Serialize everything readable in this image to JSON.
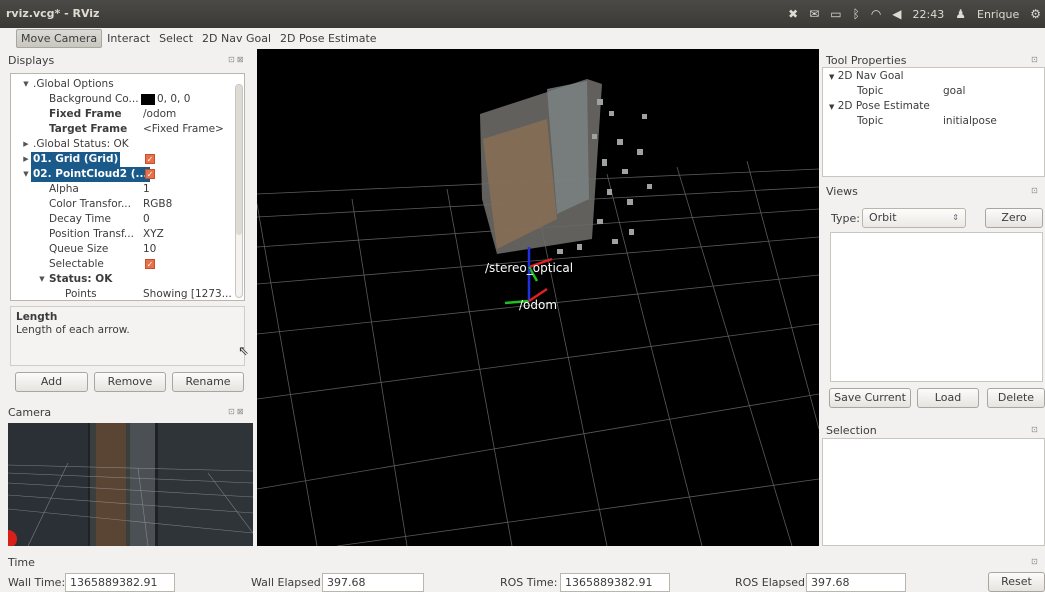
{
  "window": {
    "title": "rviz.vcg* - RViz"
  },
  "tray": {
    "time": "22:43",
    "user": "Enrique"
  },
  "toolbar": {
    "tools": [
      "Move Camera",
      "Interact",
      "Select",
      "2D Nav Goal",
      "2D Pose Estimate"
    ]
  },
  "displays": {
    "title": "Displays",
    "tree": [
      {
        "name": ".Global Options",
        "toggle": "▾",
        "level": 0
      },
      {
        "name": "Background Co...",
        "value": "0, 0, 0",
        "level": 1
      },
      {
        "name": "Fixed Frame",
        "value": "/odom",
        "level": 1,
        "bold": true
      },
      {
        "name": "Target Frame",
        "value": "<Fixed Frame>",
        "level": 1,
        "bold": true
      },
      {
        "name": ".Global Status: OK",
        "toggle": "▸",
        "level": 0
      },
      {
        "name": "01. Grid (Grid)",
        "toggle": "▸",
        "level": 0,
        "selected": true,
        "checked": true
      },
      {
        "name": "02. PointCloud2 (...",
        "toggle": "▾",
        "level": 0,
        "selected": true,
        "checked": true
      },
      {
        "name": "Alpha",
        "value": "1",
        "level": 1
      },
      {
        "name": "Color Transfor...",
        "value": "RGB8",
        "level": 1
      },
      {
        "name": "Decay Time",
        "value": "0",
        "level": 1
      },
      {
        "name": "Position Transf...",
        "value": "XYZ",
        "level": 1
      },
      {
        "name": "Queue Size",
        "value": "10",
        "level": 1
      },
      {
        "name": "Selectable",
        "value": "",
        "level": 1,
        "checked": true
      },
      {
        "name": "Status: OK",
        "toggle": "▾",
        "level": 1,
        "bold": true
      },
      {
        "name": "Points",
        "value": "Showing [1273...",
        "level": 2
      }
    ],
    "description_title": "Length",
    "description_text": "Length of each arrow.",
    "buttons": {
      "add": "Add",
      "remove": "Remove",
      "rename": "Rename"
    }
  },
  "camera": {
    "title": "Camera"
  },
  "viewport": {
    "frame_labels": [
      "/stereo_optical",
      "/odom"
    ]
  },
  "tool_properties": {
    "title": "Tool Properties",
    "items": [
      {
        "name": "2D Nav Goal",
        "topic_label": "Topic",
        "topic": "goal"
      },
      {
        "name": "2D Pose Estimate",
        "topic_label": "Topic",
        "topic": "initialpose"
      }
    ]
  },
  "views": {
    "title": "Views",
    "type_label": "Type:",
    "type_value": "Orbit",
    "zero_button": "Zero",
    "save_current_button": "Save Current",
    "load_button": "Load",
    "delete_button": "Delete"
  },
  "selection": {
    "title": "Selection"
  },
  "time": {
    "title": "Time",
    "wall_time_label": "Wall Time:",
    "wall_time": "1365889382.91",
    "wall_elapsed_label": "Wall Elapsed:",
    "wall_elapsed": "397.68",
    "ros_time_label": "ROS Time:",
    "ros_time": "1365889382.91",
    "ros_elapsed_label": "ROS Elapsed:",
    "ros_elapsed": "397.68",
    "reset_button": "Reset"
  }
}
